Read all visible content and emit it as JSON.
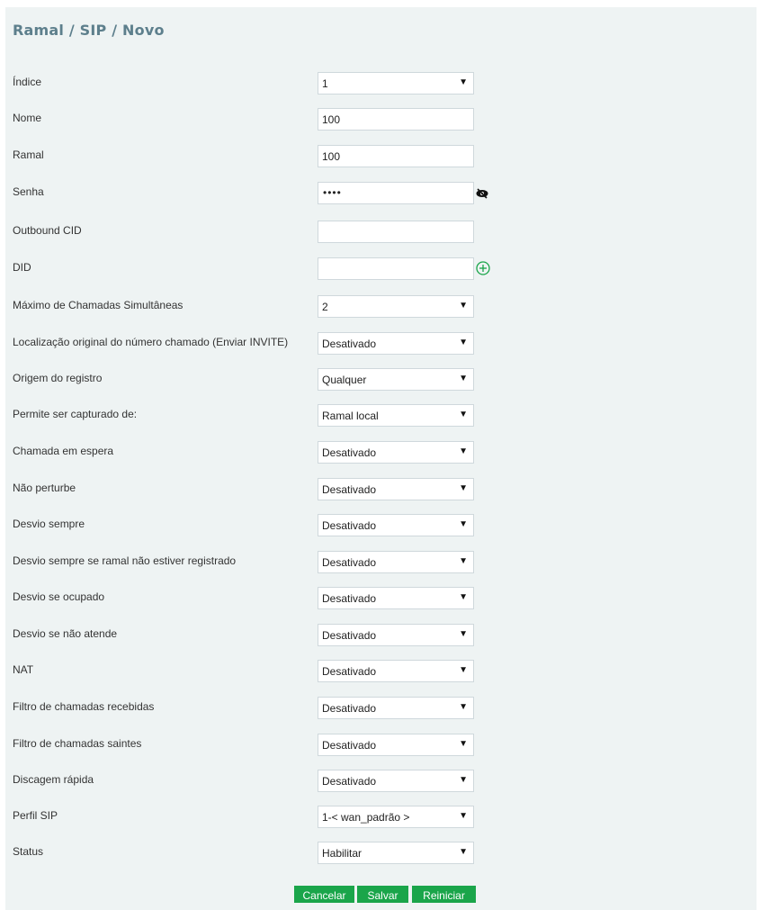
{
  "page": {
    "title": "Ramal / SIP / Novo"
  },
  "form": {
    "indice": {
      "label": "Índice",
      "value": "1"
    },
    "nome": {
      "label": "Nome",
      "value": "100"
    },
    "ramal": {
      "label": "Ramal",
      "value": "100"
    },
    "senha": {
      "label": "Senha",
      "value": "••••"
    },
    "outbound_cid": {
      "label": "Outbound CID",
      "value": ""
    },
    "did": {
      "label": "DID",
      "value": ""
    },
    "max_chamadas": {
      "label": "Máximo de Chamadas Simultâneas",
      "value": "2"
    },
    "localizacao": {
      "label": "Localização original do número chamado (Enviar INVITE)",
      "value": "Desativado"
    },
    "origem_registro": {
      "label": "Origem do registro",
      "value": "Qualquer"
    },
    "permite_captura": {
      "label": "Permite ser capturado de:",
      "value": "Ramal local"
    },
    "chamada_espera": {
      "label": "Chamada em espera",
      "value": "Desativado"
    },
    "nao_perturbe": {
      "label": "Não perturbe",
      "value": "Desativado"
    },
    "desvio_sempre": {
      "label": "Desvio sempre",
      "value": "Desativado"
    },
    "desvio_nao_registrado": {
      "label": "Desvio sempre se ramal não estiver registrado",
      "value": "Desativado"
    },
    "desvio_ocupado": {
      "label": "Desvio se ocupado",
      "value": "Desativado"
    },
    "desvio_nao_atende": {
      "label": "Desvio se não atende",
      "value": "Desativado"
    },
    "nat": {
      "label": "NAT",
      "value": "Desativado"
    },
    "filtro_recebidas": {
      "label": "Filtro de chamadas recebidas",
      "value": "Desativado"
    },
    "filtro_saintes": {
      "label": "Filtro de chamadas saintes",
      "value": "Desativado"
    },
    "discagem_rapida": {
      "label": "Discagem rápida",
      "value": "Desativado"
    },
    "perfil_sip": {
      "label": "Perfil SIP",
      "value": "1-< wan_padrão >"
    },
    "status": {
      "label": "Status",
      "value": "Habilitar"
    }
  },
  "buttons": {
    "cancel": "Cancelar",
    "save": "Salvar",
    "reset": "Reiniciar"
  },
  "icons": {
    "dropdown_caret": "▼",
    "password_toggle": "eye-slash-icon",
    "add_did": "plus-circle-icon"
  },
  "colors": {
    "panel_bg": "#eef3f3",
    "title": "#5d7f8c",
    "button_bg": "#1aa54a",
    "plus_icon": "#1aa54a"
  }
}
